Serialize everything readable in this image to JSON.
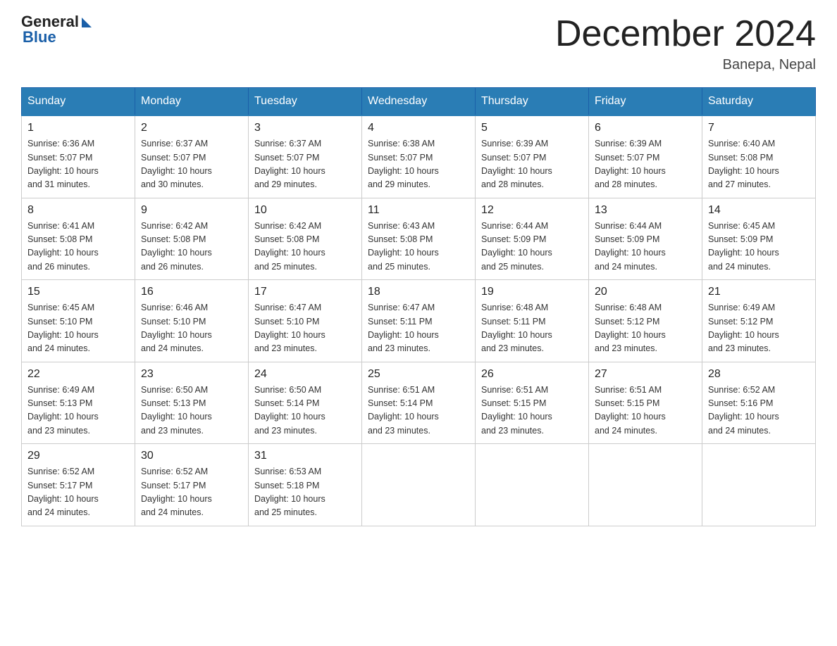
{
  "logo": {
    "general": "General",
    "blue": "Blue"
  },
  "title": "December 2024",
  "location": "Banepa, Nepal",
  "days_of_week": [
    "Sunday",
    "Monday",
    "Tuesday",
    "Wednesday",
    "Thursday",
    "Friday",
    "Saturday"
  ],
  "weeks": [
    [
      {
        "day": "1",
        "sunrise": "6:36 AM",
        "sunset": "5:07 PM",
        "daylight": "10 hours and 31 minutes."
      },
      {
        "day": "2",
        "sunrise": "6:37 AM",
        "sunset": "5:07 PM",
        "daylight": "10 hours and 30 minutes."
      },
      {
        "day": "3",
        "sunrise": "6:37 AM",
        "sunset": "5:07 PM",
        "daylight": "10 hours and 29 minutes."
      },
      {
        "day": "4",
        "sunrise": "6:38 AM",
        "sunset": "5:07 PM",
        "daylight": "10 hours and 29 minutes."
      },
      {
        "day": "5",
        "sunrise": "6:39 AM",
        "sunset": "5:07 PM",
        "daylight": "10 hours and 28 minutes."
      },
      {
        "day": "6",
        "sunrise": "6:39 AM",
        "sunset": "5:07 PM",
        "daylight": "10 hours and 28 minutes."
      },
      {
        "day": "7",
        "sunrise": "6:40 AM",
        "sunset": "5:08 PM",
        "daylight": "10 hours and 27 minutes."
      }
    ],
    [
      {
        "day": "8",
        "sunrise": "6:41 AM",
        "sunset": "5:08 PM",
        "daylight": "10 hours and 26 minutes."
      },
      {
        "day": "9",
        "sunrise": "6:42 AM",
        "sunset": "5:08 PM",
        "daylight": "10 hours and 26 minutes."
      },
      {
        "day": "10",
        "sunrise": "6:42 AM",
        "sunset": "5:08 PM",
        "daylight": "10 hours and 25 minutes."
      },
      {
        "day": "11",
        "sunrise": "6:43 AM",
        "sunset": "5:08 PM",
        "daylight": "10 hours and 25 minutes."
      },
      {
        "day": "12",
        "sunrise": "6:44 AM",
        "sunset": "5:09 PM",
        "daylight": "10 hours and 25 minutes."
      },
      {
        "day": "13",
        "sunrise": "6:44 AM",
        "sunset": "5:09 PM",
        "daylight": "10 hours and 24 minutes."
      },
      {
        "day": "14",
        "sunrise": "6:45 AM",
        "sunset": "5:09 PM",
        "daylight": "10 hours and 24 minutes."
      }
    ],
    [
      {
        "day": "15",
        "sunrise": "6:45 AM",
        "sunset": "5:10 PM",
        "daylight": "10 hours and 24 minutes."
      },
      {
        "day": "16",
        "sunrise": "6:46 AM",
        "sunset": "5:10 PM",
        "daylight": "10 hours and 24 minutes."
      },
      {
        "day": "17",
        "sunrise": "6:47 AM",
        "sunset": "5:10 PM",
        "daylight": "10 hours and 23 minutes."
      },
      {
        "day": "18",
        "sunrise": "6:47 AM",
        "sunset": "5:11 PM",
        "daylight": "10 hours and 23 minutes."
      },
      {
        "day": "19",
        "sunrise": "6:48 AM",
        "sunset": "5:11 PM",
        "daylight": "10 hours and 23 minutes."
      },
      {
        "day": "20",
        "sunrise": "6:48 AM",
        "sunset": "5:12 PM",
        "daylight": "10 hours and 23 minutes."
      },
      {
        "day": "21",
        "sunrise": "6:49 AM",
        "sunset": "5:12 PM",
        "daylight": "10 hours and 23 minutes."
      }
    ],
    [
      {
        "day": "22",
        "sunrise": "6:49 AM",
        "sunset": "5:13 PM",
        "daylight": "10 hours and 23 minutes."
      },
      {
        "day": "23",
        "sunrise": "6:50 AM",
        "sunset": "5:13 PM",
        "daylight": "10 hours and 23 minutes."
      },
      {
        "day": "24",
        "sunrise": "6:50 AM",
        "sunset": "5:14 PM",
        "daylight": "10 hours and 23 minutes."
      },
      {
        "day": "25",
        "sunrise": "6:51 AM",
        "sunset": "5:14 PM",
        "daylight": "10 hours and 23 minutes."
      },
      {
        "day": "26",
        "sunrise": "6:51 AM",
        "sunset": "5:15 PM",
        "daylight": "10 hours and 23 minutes."
      },
      {
        "day": "27",
        "sunrise": "6:51 AM",
        "sunset": "5:15 PM",
        "daylight": "10 hours and 24 minutes."
      },
      {
        "day": "28",
        "sunrise": "6:52 AM",
        "sunset": "5:16 PM",
        "daylight": "10 hours and 24 minutes."
      }
    ],
    [
      {
        "day": "29",
        "sunrise": "6:52 AM",
        "sunset": "5:17 PM",
        "daylight": "10 hours and 24 minutes."
      },
      {
        "day": "30",
        "sunrise": "6:52 AM",
        "sunset": "5:17 PM",
        "daylight": "10 hours and 24 minutes."
      },
      {
        "day": "31",
        "sunrise": "6:53 AM",
        "sunset": "5:18 PM",
        "daylight": "10 hours and 25 minutes."
      },
      null,
      null,
      null,
      null
    ]
  ],
  "labels": {
    "sunrise": "Sunrise:",
    "sunset": "Sunset:",
    "daylight": "Daylight:"
  }
}
